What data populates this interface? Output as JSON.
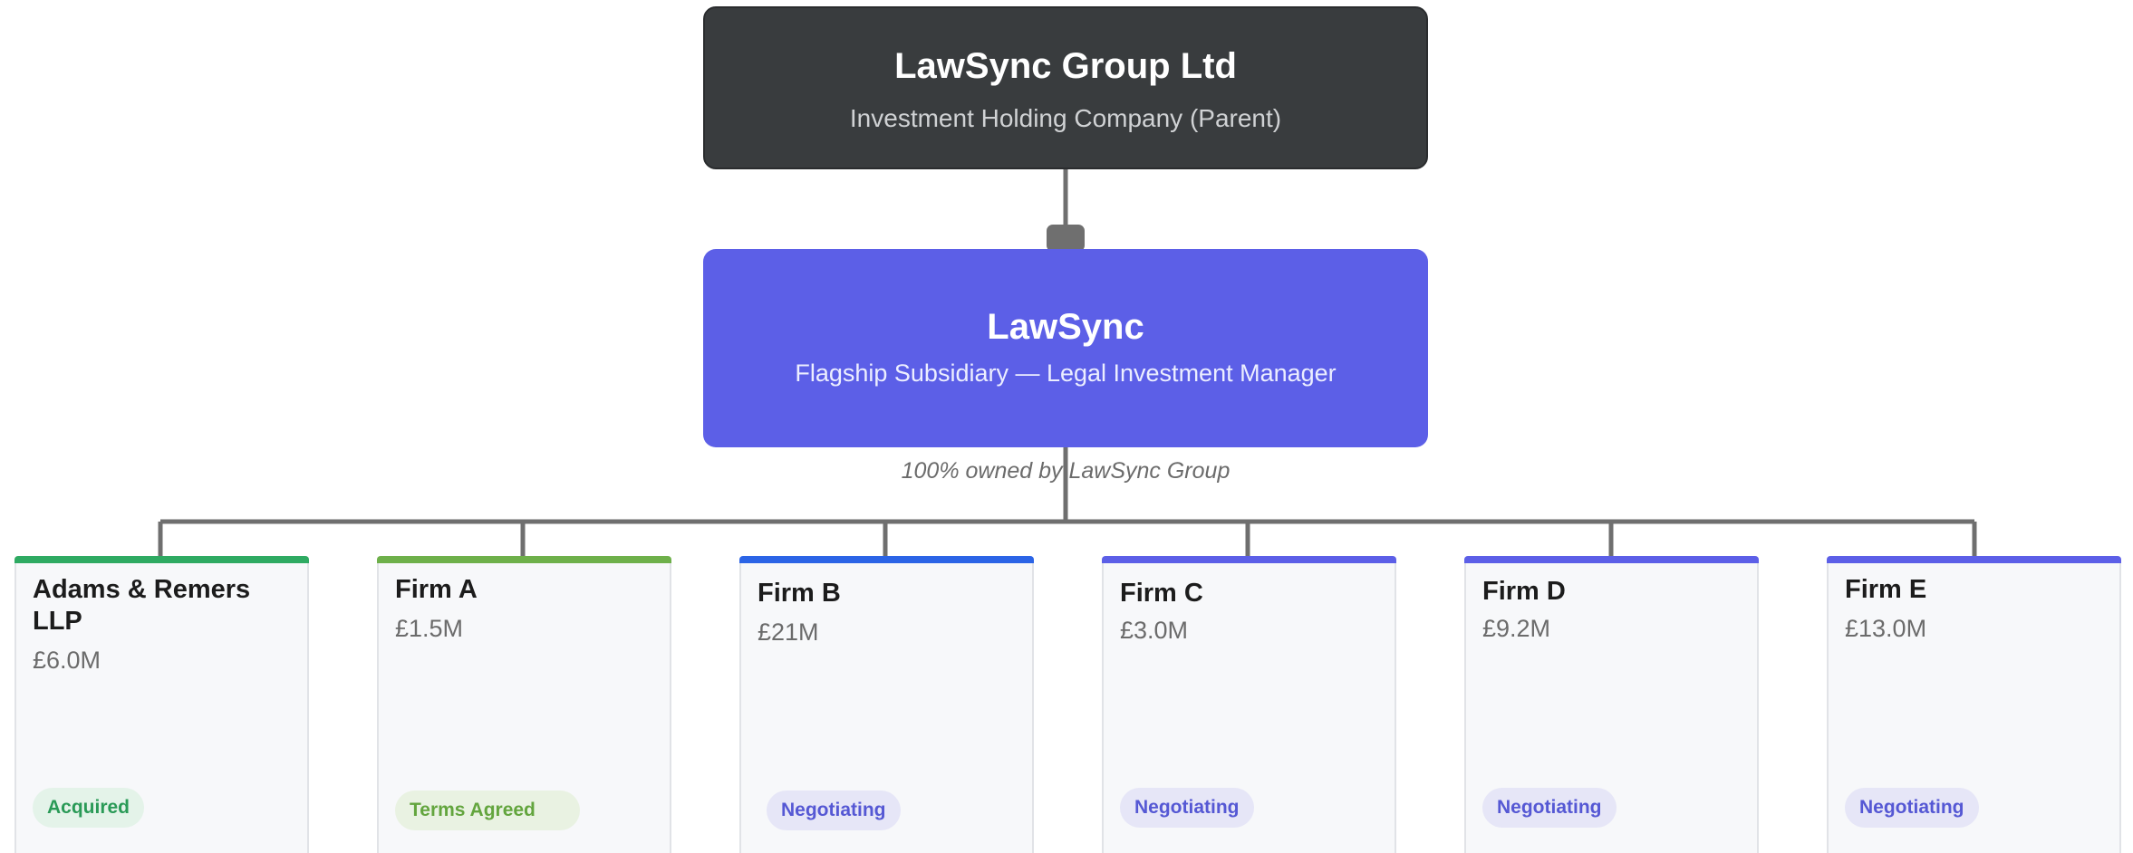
{
  "parent": {
    "name": "LawSync Group Ltd",
    "description": "Investment Holding Company (Parent)"
  },
  "subsidiary": {
    "name": "LawSync",
    "description": "Flagship Subsidiary — Legal Investment Manager",
    "ownership_note": "100% owned by LawSync Group"
  },
  "colors": {
    "parent_fill": "#393c3e",
    "subsidiary_fill": "#5c5fe7",
    "connector": "#6f6f6f",
    "acquired": "#2eaa62",
    "terms_agreed": "#6eb04a",
    "negotiating_firm_b": "#2b64e6",
    "negotiating": "#5c5fe7"
  },
  "firms": [
    {
      "name": "Adams & Remers LLP",
      "value": "£6.0M",
      "status": "Acquired",
      "accent_color": "#2eaa62",
      "badge_text_color": "#2a9a57",
      "badge_bg_color": "#e4f3e9"
    },
    {
      "name": "Firm A",
      "value": "£1.5M",
      "status": "Terms Agreed",
      "accent_color": "#6eb04a",
      "badge_text_color": "#63a53e",
      "badge_bg_color": "#e9f2e2"
    },
    {
      "name": "Firm B",
      "value": "£21M",
      "status": "Negotiating",
      "accent_color": "#2b64e6",
      "badge_text_color": "#5558d4",
      "badge_bg_color": "#e6e6f7"
    },
    {
      "name": "Firm C",
      "value": "£3.0M",
      "status": "Negotiating",
      "accent_color": "#5c5fe7",
      "badge_text_color": "#5558d4",
      "badge_bg_color": "#e6e6f7"
    },
    {
      "name": "Firm D",
      "value": "£9.2M",
      "status": "Negotiating",
      "accent_color": "#5c5fe7",
      "badge_text_color": "#5558d4",
      "badge_bg_color": "#e6e6f7"
    },
    {
      "name": "Firm E",
      "value": "£13.0M",
      "status": "Negotiating",
      "accent_color": "#5c5fe7",
      "badge_text_color": "#5558d4",
      "badge_bg_color": "#e6e6f7"
    }
  ]
}
